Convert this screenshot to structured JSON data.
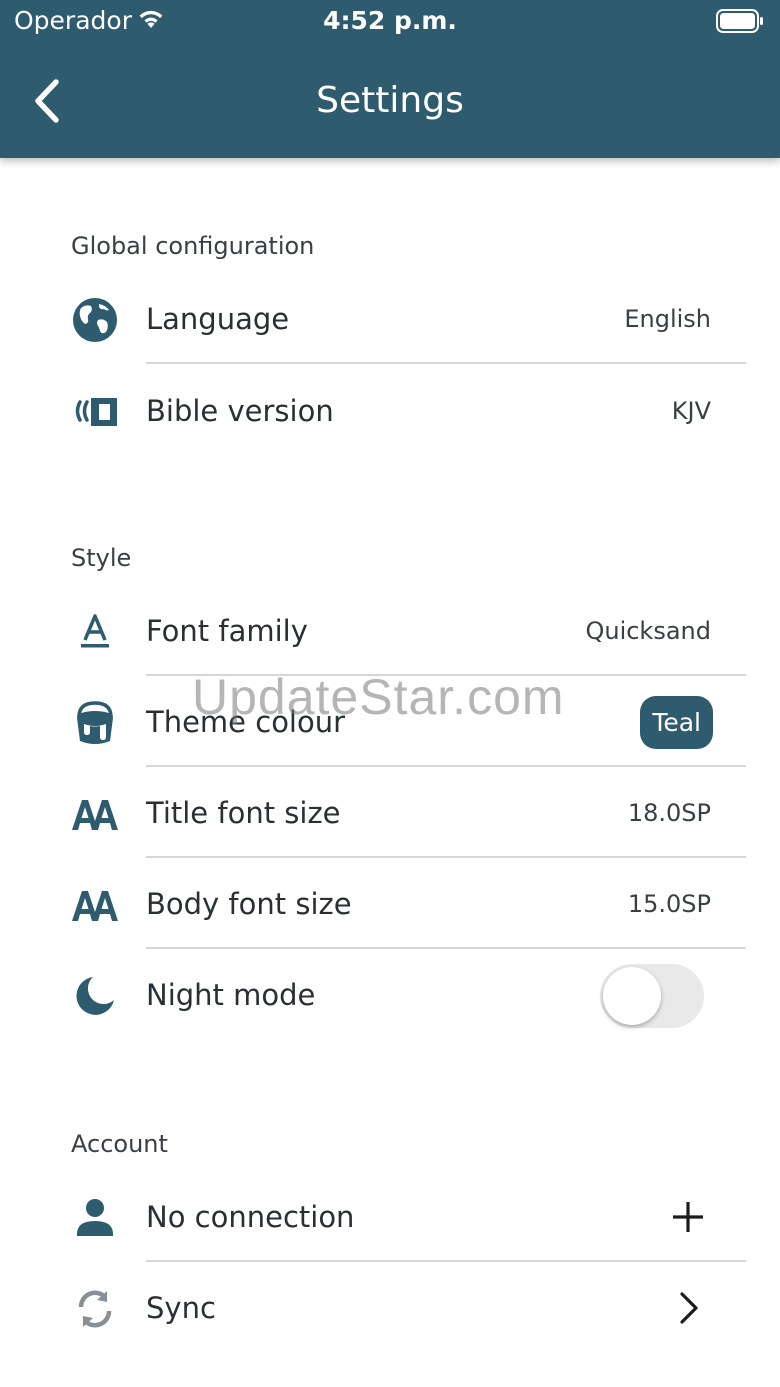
{
  "status_bar": {
    "carrier": "Operador",
    "time": "4:52 p.m."
  },
  "header": {
    "title": "Settings",
    "back_icon": "chevron-left-icon"
  },
  "colors": {
    "primary": "#2e5b6e",
    "sync_icon": "#8a8f93"
  },
  "sections": {
    "global": {
      "title": "Global configuration",
      "language": {
        "label": "Language",
        "value": "English",
        "icon": "globe-icon"
      },
      "bible_version": {
        "label": "Bible version",
        "value": "KJV",
        "icon": "bible-version-icon"
      }
    },
    "style": {
      "title": "Style",
      "font_family": {
        "label": "Font family",
        "value": "Quicksand",
        "icon": "font-icon"
      },
      "theme_colour": {
        "label": "Theme colour",
        "value": "Teal",
        "icon": "paint-bucket-icon"
      },
      "title_font_size": {
        "label": "Title font size",
        "value": "18.0SP",
        "icon": "text-size-icon"
      },
      "body_font_size": {
        "label": "Body font size",
        "value": "15.0SP",
        "icon": "text-size-icon"
      },
      "night_mode": {
        "label": "Night mode",
        "enabled": false,
        "icon": "moon-icon"
      }
    },
    "account": {
      "title": "Account",
      "connection": {
        "label": "No connection",
        "icon": "person-icon",
        "action_icon": "plus-icon"
      },
      "sync": {
        "label": "Sync",
        "icon": "sync-icon",
        "action_icon": "chevron-right-icon"
      }
    }
  },
  "watermark": "UpdateStar.com"
}
